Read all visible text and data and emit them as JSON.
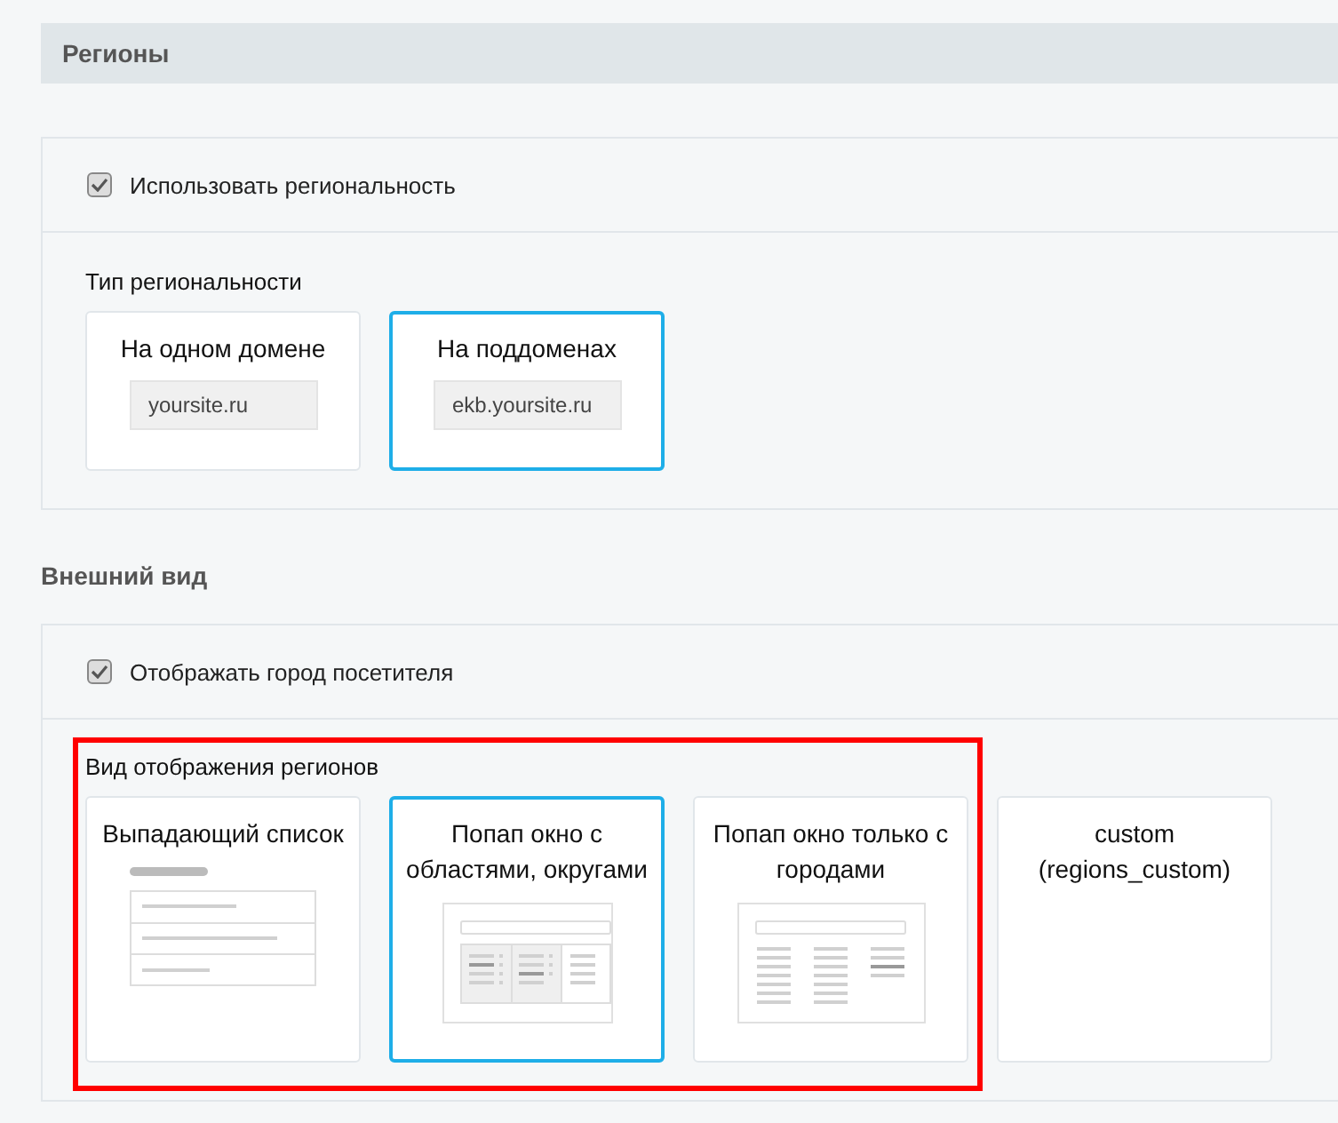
{
  "header": {
    "title": "Регионы"
  },
  "regionality": {
    "checkbox": {
      "label": "Использовать региональность",
      "checked": true
    },
    "type_label": "Тип региональности",
    "options": [
      {
        "title": "На одном домене",
        "example": "yoursite.ru",
        "selected": false
      },
      {
        "title": "На поддоменах",
        "example": "ekb.yoursite.ru",
        "selected": true
      }
    ]
  },
  "appearance": {
    "title": "Внешний вид",
    "checkbox": {
      "label": "Отображать город посетителя",
      "checked": true
    },
    "display_label": "Вид отображения регионов",
    "highlighted": true,
    "options": [
      {
        "title": "Выпадающий список",
        "kind": "dropdown",
        "selected": false
      },
      {
        "title": "Попап окно с областями, округами",
        "kind": "popup-regions",
        "selected": true
      },
      {
        "title": "Попап окно только с городами",
        "kind": "popup-cities",
        "selected": false
      },
      {
        "title": "custom (regions_custom)",
        "kind": "custom",
        "selected": false
      }
    ]
  }
}
